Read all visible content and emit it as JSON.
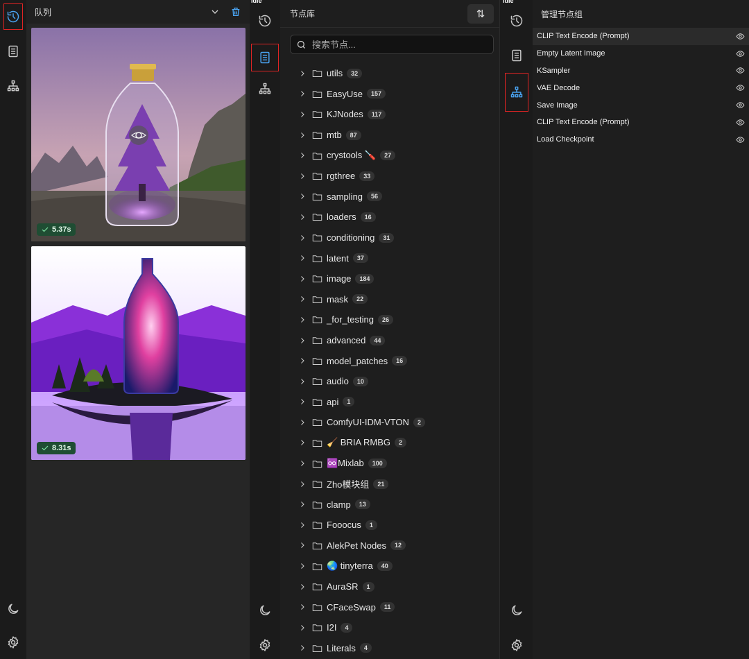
{
  "status": {
    "idle_label": "idle"
  },
  "queue": {
    "title": "队列",
    "items": [
      {
        "time": "5.37s"
      },
      {
        "time": "8.31s"
      }
    ]
  },
  "library": {
    "title": "节点库",
    "sort_icon": "sort-arrows-icon",
    "search_placeholder": "搜索节点...",
    "folders": [
      {
        "name": "utils",
        "count": "32"
      },
      {
        "name": "EasyUse",
        "count": "157"
      },
      {
        "name": "KJNodes",
        "count": "117"
      },
      {
        "name": "mtb",
        "count": "87"
      },
      {
        "name": "crystools 🪛",
        "count": "27"
      },
      {
        "name": "rgthree",
        "count": "33"
      },
      {
        "name": "sampling",
        "count": "56"
      },
      {
        "name": "loaders",
        "count": "16"
      },
      {
        "name": "conditioning",
        "count": "31"
      },
      {
        "name": "latent",
        "count": "37"
      },
      {
        "name": "image",
        "count": "184"
      },
      {
        "name": "mask",
        "count": "22"
      },
      {
        "name": "_for_testing",
        "count": "26"
      },
      {
        "name": "advanced",
        "count": "44"
      },
      {
        "name": "model_patches",
        "count": "16"
      },
      {
        "name": "audio",
        "count": "10"
      },
      {
        "name": "api",
        "count": "1"
      },
      {
        "name": "ComfyUI-IDM-VTON",
        "count": "2"
      },
      {
        "name": "🧹 BRIA RMBG",
        "count": "2"
      },
      {
        "name": "♾️Mixlab",
        "count": "100"
      },
      {
        "name": "Zho模块组",
        "count": "21"
      },
      {
        "name": "clamp",
        "count": "13"
      },
      {
        "name": "Fooocus",
        "count": "1"
      },
      {
        "name": "AlekPet Nodes",
        "count": "12"
      },
      {
        "name": "🌏 tinyterra",
        "count": "40"
      },
      {
        "name": "AuraSR",
        "count": "1"
      },
      {
        "name": "CFaceSwap",
        "count": "11"
      },
      {
        "name": "I2I",
        "count": "4"
      },
      {
        "name": "Literals",
        "count": "4"
      }
    ]
  },
  "manager": {
    "title": "管理节点组",
    "items": [
      "CLIP Text Encode (Prompt)",
      "Empty Latent Image",
      "KSampler",
      "VAE Decode",
      "Save Image",
      "CLIP Text Encode (Prompt)",
      "Load Checkpoint"
    ]
  },
  "colors": {
    "accent": "#4aa3f0",
    "highlight": "#e02424",
    "badge_bg": "#1f4d33"
  }
}
